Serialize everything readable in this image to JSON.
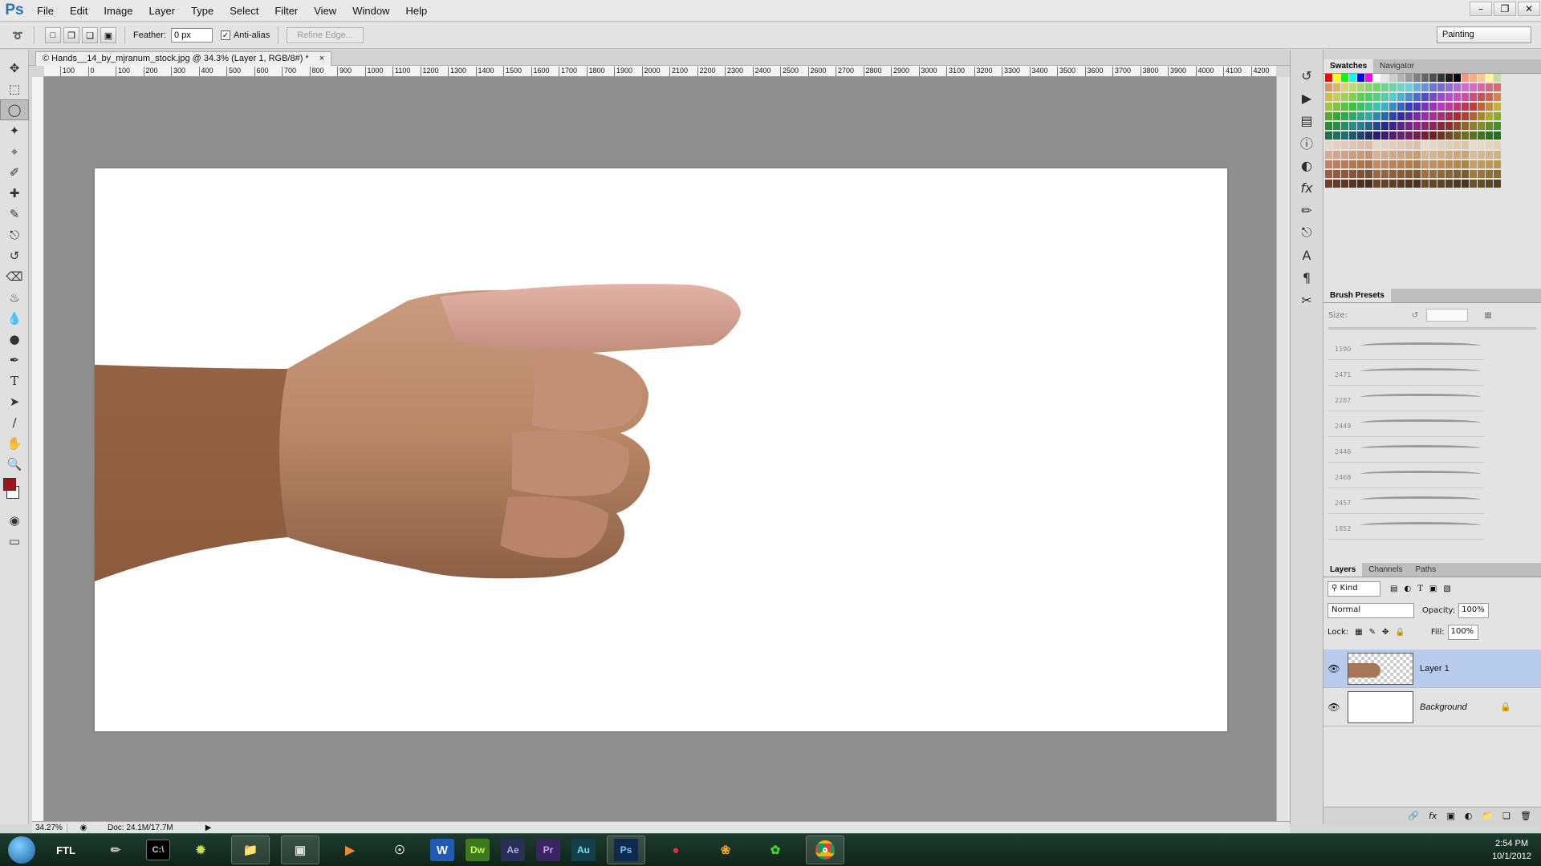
{
  "app": {
    "logo": "Ps"
  },
  "menu": [
    "File",
    "Edit",
    "Image",
    "Layer",
    "Type",
    "Select",
    "Filter",
    "View",
    "Window",
    "Help"
  ],
  "window_controls": [
    "minimize-icon",
    "restore-icon",
    "close-icon"
  ],
  "options": {
    "feather_label": "Feather:",
    "feather_value": "0 px",
    "antialias_label": "Anti-alias",
    "antialias_checked": true,
    "refine_label": "Refine Edge...",
    "workspace": "Painting"
  },
  "document": {
    "tab_title": "© Hands__14_by_mjranum_stock.jpg @ 34.3% (Layer 1, RGB/8#) *",
    "zoom": "34.27%",
    "doc_size": "Doc: 24.1M/17.7M",
    "ruler_ticks": [
      "100",
      "0",
      "100",
      "200",
      "300",
      "400",
      "500",
      "600",
      "700",
      "800",
      "900",
      "1000",
      "1100",
      "1200",
      "1300",
      "1400",
      "1500",
      "1600",
      "1700",
      "1800",
      "1900",
      "2000",
      "2100",
      "2200",
      "2300",
      "2400",
      "2500",
      "2600",
      "2700",
      "2800",
      "2900",
      "3000",
      "3100",
      "3200",
      "3300",
      "3400",
      "3500",
      "3600",
      "3700",
      "3800",
      "3900",
      "4000",
      "4100",
      "4200"
    ]
  },
  "colors": {
    "foreground": "#a0141a",
    "background": "#ffffff",
    "layer_selected": "#b8cdee"
  },
  "panels": {
    "swatches_tabs": [
      "Swatches",
      "Navigator"
    ],
    "brush_title": "Brush Presets",
    "brush_size_label": "Size:",
    "brush_sizes": [
      "1190",
      "2471",
      "2287",
      "2449",
      "2446",
      "2468",
      "2457",
      "1852"
    ],
    "layers_tabs": [
      "Layers",
      "Channels",
      "Paths"
    ],
    "kind_label": "Kind",
    "blend_mode": "Normal",
    "opacity_label": "Opacity:",
    "opacity_value": "100%",
    "lock_label": "Lock:",
    "fill_label": "Fill:",
    "fill_value": "100%",
    "layers": [
      {
        "name": "Layer 1",
        "selected": true
      },
      {
        "name": "Background",
        "selected": false,
        "locked": true
      }
    ]
  },
  "taskbar": {
    "items": [
      "start-orb",
      "FTL",
      "pen-app",
      "cmd",
      "spiral-app",
      "explorer",
      "win-app",
      "media-player",
      "compass-app",
      "Word",
      "Dw",
      "Ae",
      "Pr",
      "Au",
      "Ps",
      "red-app",
      "fl-studio",
      "razer",
      "chrome"
    ],
    "time": "2:54 PM",
    "date": "10/1/2012"
  }
}
